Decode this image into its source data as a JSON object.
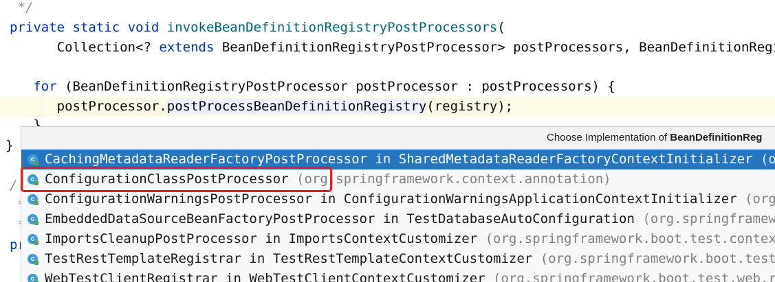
{
  "code": {
    "lines": [
      {
        "text": " */"
      },
      {
        "kw": "private static void ",
        "fn": "invokeBeanDefinitionRegistryPostProcessors",
        "rest": "("
      },
      {
        "pre": "      Collection<? ",
        "kw": "extends",
        "rest": " BeanDefinitionRegistryPostProcessor> postProcessors, BeanDefinitionRegist"
      },
      {
        "text": ""
      },
      {
        "pre": "   ",
        "kw": "for",
        "rest": " (BeanDefinitionRegistryPostProcessor postProcessor : postProcessors) {"
      },
      {
        "pre": "      postProcessor.",
        "call": "postProcessBeanDefinitionRegistry",
        "rest": "(registry);"
      },
      {
        "text": "   }"
      },
      {
        "text": "}"
      },
      {
        "text": "/"
      },
      {
        "text": " *"
      },
      {
        "text": " *"
      },
      {
        "text": "pr"
      }
    ]
  },
  "popup": {
    "header_prefix": "Choose Implementation of ",
    "header_bold": "BeanDefinitionReg",
    "icon_letter": "c",
    "items": [
      {
        "name": "CachingMetadataReaderFactoryPostProcessor",
        "in": " in SharedMetadataReaderFactoryContextInitializer",
        "pkg": " (org.s"
      },
      {
        "name": "ConfigurationClassPostProcessor",
        "in": "",
        "pkg": " (org.springframework.context.annotation)"
      },
      {
        "name": "ConfigurationWarningsPostProcessor",
        "in": " in ConfigurationWarningsApplicationContextInitializer",
        "pkg": " (org.spr"
      },
      {
        "name": "EmbeddedDataSourceBeanFactoryPostProcessor",
        "in": " in TestDatabaseAutoConfiguration",
        "pkg": " (org.springframework."
      },
      {
        "name": "ImportsCleanupPostProcessor",
        "in": " in ImportsContextCustomizer",
        "pkg": " (org.springframework.boot.test.context)"
      },
      {
        "name": "TestRestTemplateRegistrar",
        "in": " in TestRestTemplateContextCustomizer",
        "pkg": " (org.springframework.boot.test.web"
      },
      {
        "name": "WebTestClientRegistrar",
        "in": " in WebTestClientContextCustomizer",
        "pkg": " (org.springframework.boot.test.web.react"
      }
    ]
  },
  "colors": {
    "selection": "#2675bf",
    "highlight_box": "#e02020",
    "keyword": "#0033b3",
    "method": "#00627a"
  }
}
